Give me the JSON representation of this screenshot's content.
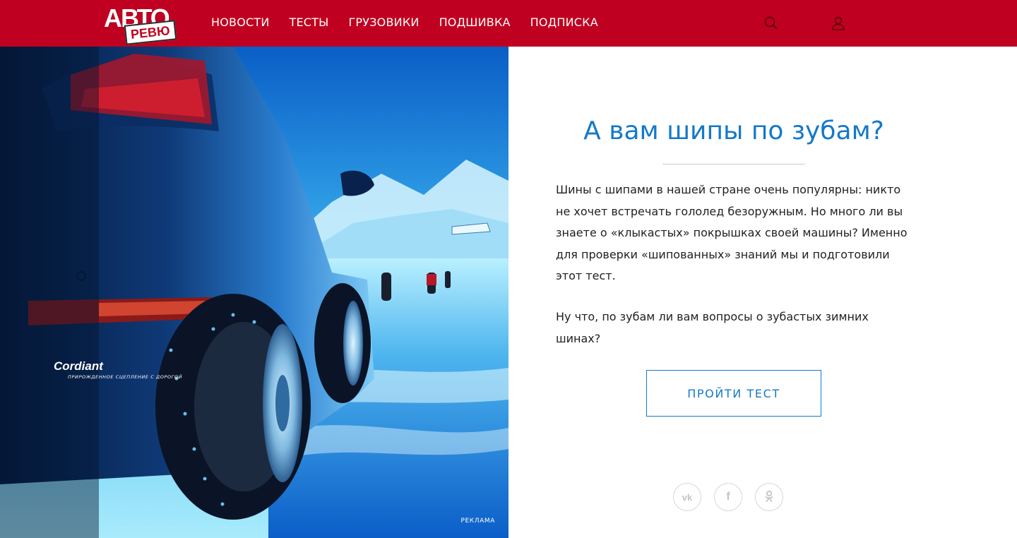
{
  "header": {
    "logo_top": "АВТО",
    "logo_bottom": "РЕВЮ",
    "nav": [
      "НОВОСТИ",
      "ТЕСТЫ",
      "ГРУЗОВИКИ",
      "ПОДШИВКА",
      "ПОДПИСКА"
    ],
    "icons": [
      "search-icon",
      "user-icon"
    ],
    "bg_color": "#c00020"
  },
  "promo": {
    "brand": "Cordiant",
    "tagline": "ПРИРОЖДЕННОЕ СЦЕПЛЕНИЕ С ДОРОГОЙ",
    "ad_label": "РЕКЛАМА"
  },
  "article": {
    "title": "А вам шипы по зубам?",
    "paragraph_1": "Шины с шипами в нашей стране очень популярны: никто не хочет встречать гололед безоружным. Но много ли вы знаете о «клыкастых» покрышках своей машины? Именно для проверки «шипованных» знаний мы и подготовили этот тест.",
    "paragraph_2": "Ну что, по зубам ли вам вопросы о зубастых зимних шинах?",
    "cta_label": "ПРОЙТИ ТЕСТ",
    "accent_color": "#1479c9"
  },
  "share": {
    "items": [
      {
        "icon": "vk-icon",
        "glyph": "vk"
      },
      {
        "icon": "facebook-icon",
        "glyph": "f"
      },
      {
        "icon": "odnoklassniki-icon",
        "glyph": "ok"
      }
    ]
  }
}
